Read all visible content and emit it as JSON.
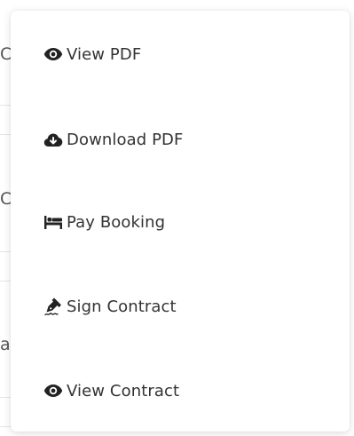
{
  "background": {
    "fragments": [
      "C",
      "C",
      "a"
    ]
  },
  "menu": {
    "items": [
      {
        "id": "view-pdf",
        "label": "View PDF",
        "icon": "eye-icon"
      },
      {
        "id": "download-pdf",
        "label": "Download PDF",
        "icon": "cloud-download-icon"
      },
      {
        "id": "pay-booking",
        "label": "Pay Booking",
        "icon": "bed-icon"
      },
      {
        "id": "sign-contract",
        "label": "Sign Contract",
        "icon": "signature-icon"
      },
      {
        "id": "view-contract",
        "label": "View Contract",
        "icon": "eye-icon"
      }
    ]
  },
  "colors": {
    "text": "#333333",
    "icon": "#222222",
    "menu_bg": "#ffffff"
  }
}
